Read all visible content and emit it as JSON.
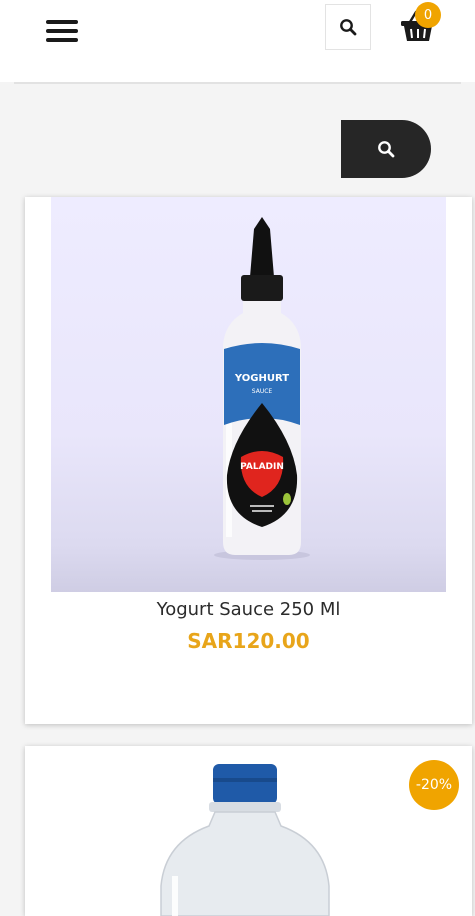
{
  "header": {
    "menu_icon": "hamburger-menu-icon",
    "search_icon": "search-icon",
    "cart_icon": "basket-icon",
    "cart_count": "0"
  },
  "search_bar": {
    "icon": "search-icon"
  },
  "products": [
    {
      "name": "Yogurt Sauce 250 Ml",
      "price": "SAR120.00",
      "label_top": "YOGHURT",
      "label_sub": "SAUCE",
      "brand": "PALADIN"
    },
    {
      "discount": "-20%"
    }
  ],
  "colors": {
    "accent": "#f0a400",
    "price": "#e8a51a",
    "dark": "#262626"
  }
}
